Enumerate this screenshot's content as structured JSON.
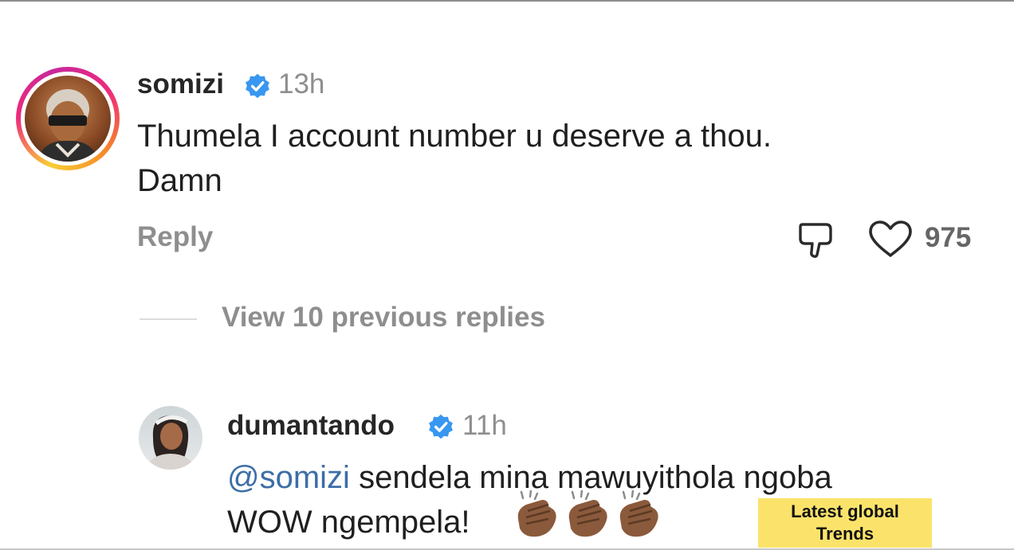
{
  "main_comment": {
    "username": "somizi",
    "verified_icon": "verified-badge-icon",
    "timestamp": "13h",
    "text_lines": [
      "Thumela I account number u deserve a thou.",
      "Damn"
    ],
    "reply_label": "Reply",
    "like_count": "975",
    "icons": [
      "avatar",
      "dislike-icon",
      "heart-icon"
    ]
  },
  "view_replies": {
    "label": "View 10 previous replies"
  },
  "reply_comment": {
    "username": "dumantando",
    "verified_icon": "verified-badge-icon",
    "timestamp": "11h",
    "mention": "@somizi",
    "text_rest_line1": " sendela mina mawuyithola ngoba",
    "text_line2": "WOW ngempela!",
    "emoji": [
      "clapping-hands",
      "clapping-hands",
      "clapping-hands"
    ]
  },
  "watermark": {
    "line1": "Latest global",
    "line2": "Trends"
  },
  "colors": {
    "verified_blue": "#3897f0",
    "mention_blue": "#3d6ea6",
    "watermark_yellow": "#fbe36b",
    "muted_gray": "#8e8e8e"
  }
}
